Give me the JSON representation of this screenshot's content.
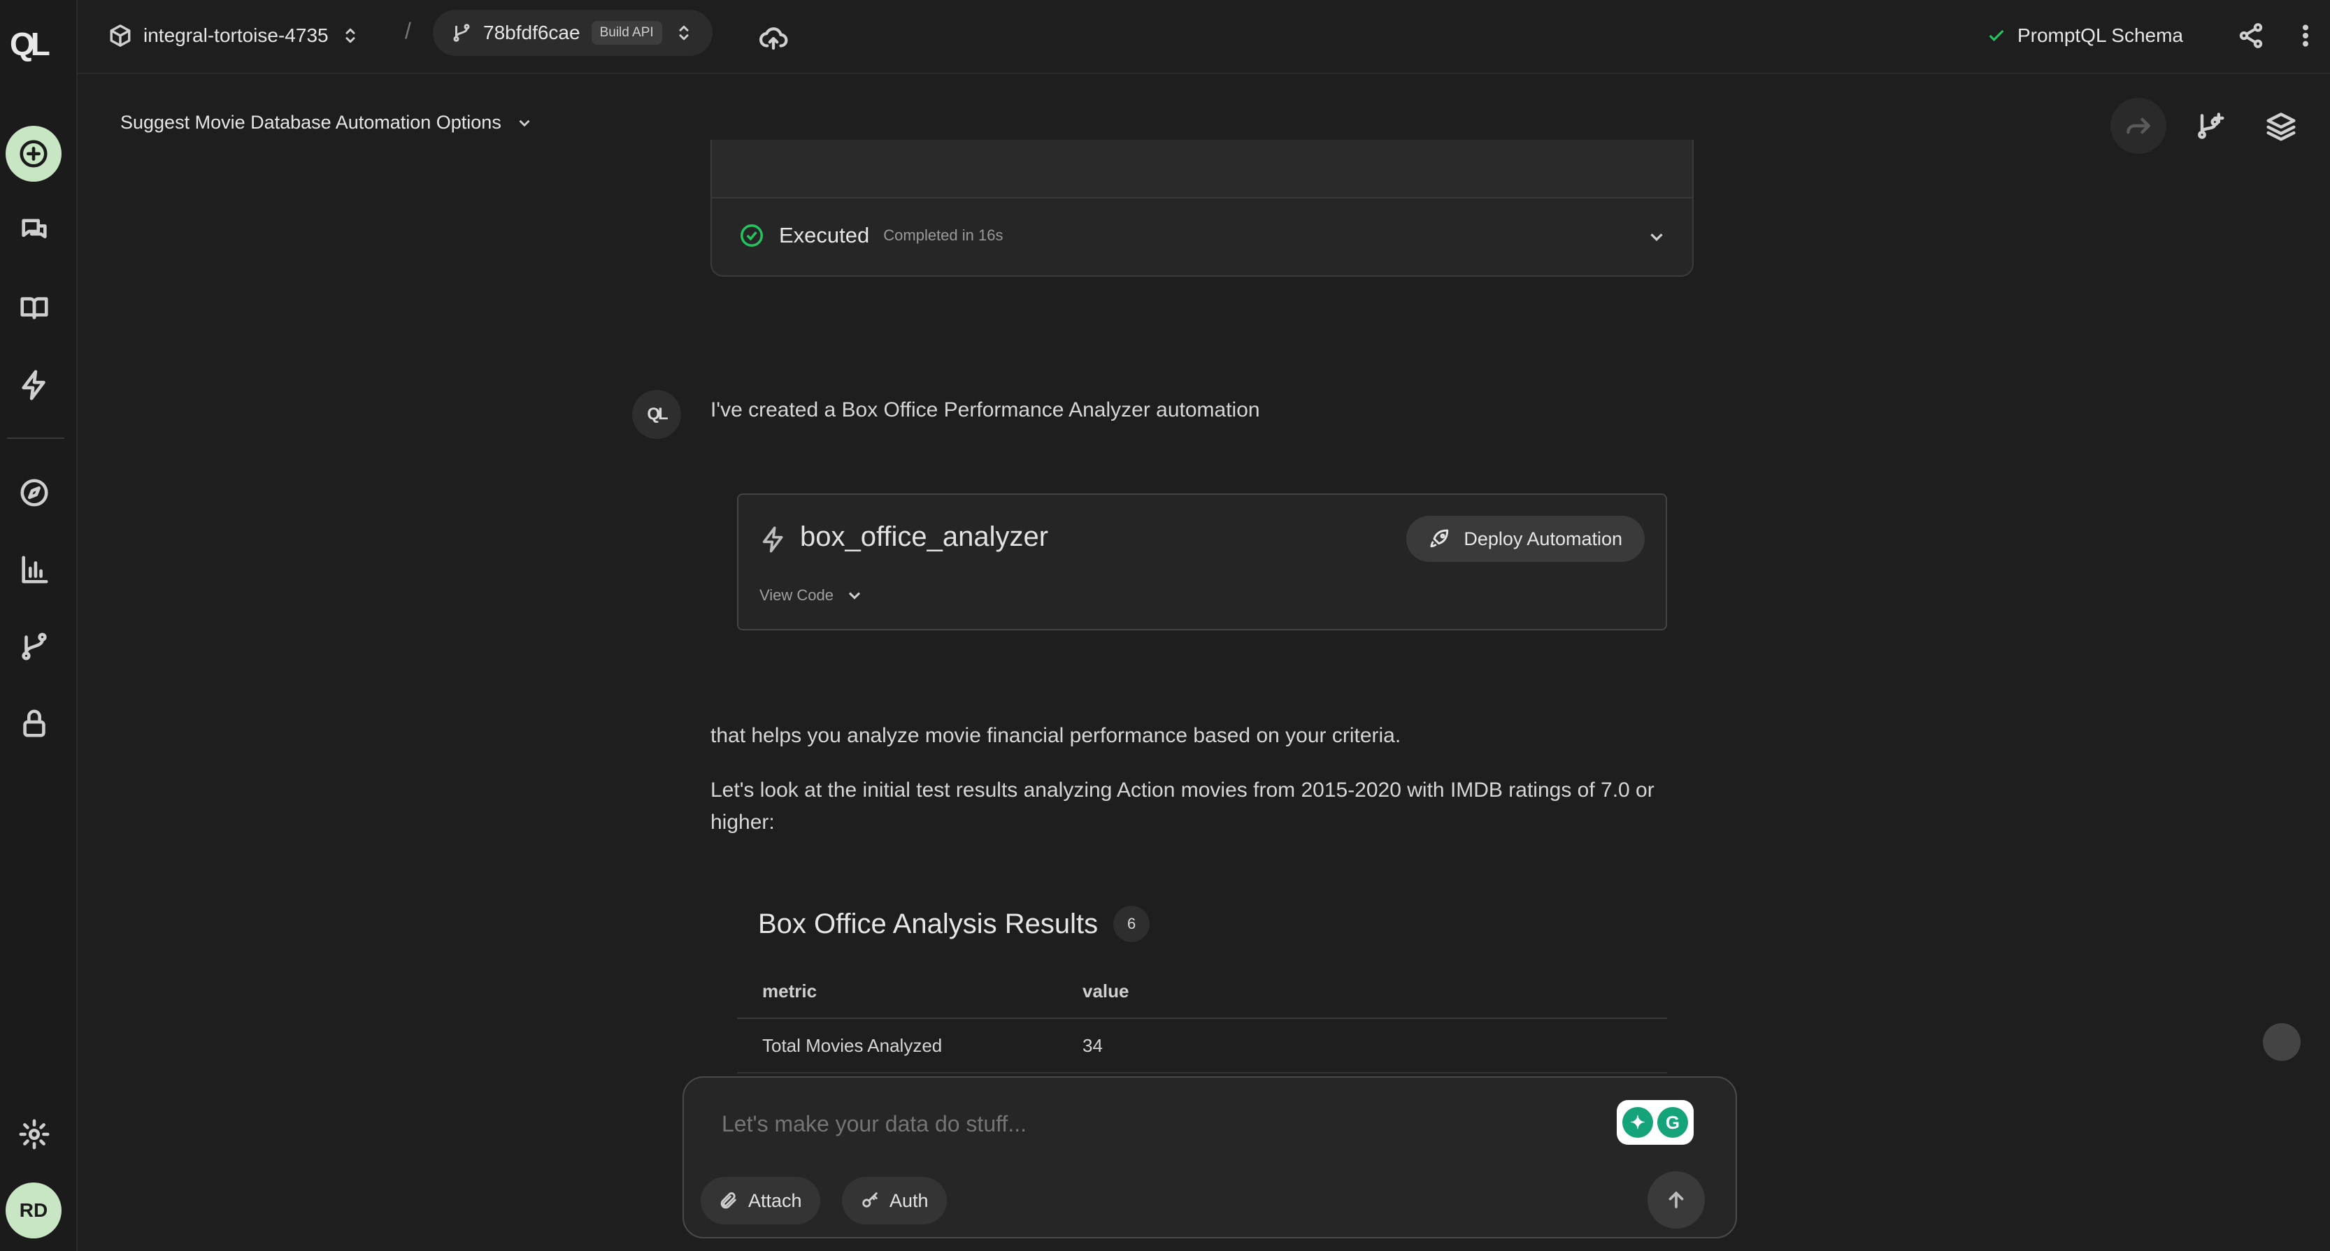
{
  "app": {
    "logo": "QL",
    "accent_color": "#c8e6c3",
    "user_initials": "RD"
  },
  "topbar": {
    "project_name": "integral-tortoise-4735",
    "separator": "/",
    "build_id": "78bfdf6cae",
    "build_badge": "Build API",
    "schema_label": "PromptQL Schema",
    "schema_status_color": "#22c55e"
  },
  "thread": {
    "title": "Suggest Movie Database Automation Options"
  },
  "execution": {
    "status": "Executed",
    "detail": "Completed in 16s"
  },
  "assistant": {
    "avatar": "QL",
    "intro": "I've created a Box Office Performance Analyzer automation",
    "followup": "that helps you analyze movie financial performance based on your criteria.",
    "results_intro": "Let's look at the initial test results analyzing Action movies from 2015-2020 with IMDB ratings of 7.0 or higher:"
  },
  "automation": {
    "name": "box_office_analyzer",
    "deploy_label": "Deploy Automation",
    "view_code_label": "View Code"
  },
  "results_table": {
    "title": "Box Office Analysis Results",
    "row_count": "6",
    "columns": [
      "metric",
      "value"
    ],
    "rows": [
      {
        "metric": "Total Movies Analyzed",
        "value": "34"
      }
    ]
  },
  "composer": {
    "placeholder": "Let's make your data do stuff...",
    "attach_label": "Attach",
    "auth_label": "Auth"
  }
}
